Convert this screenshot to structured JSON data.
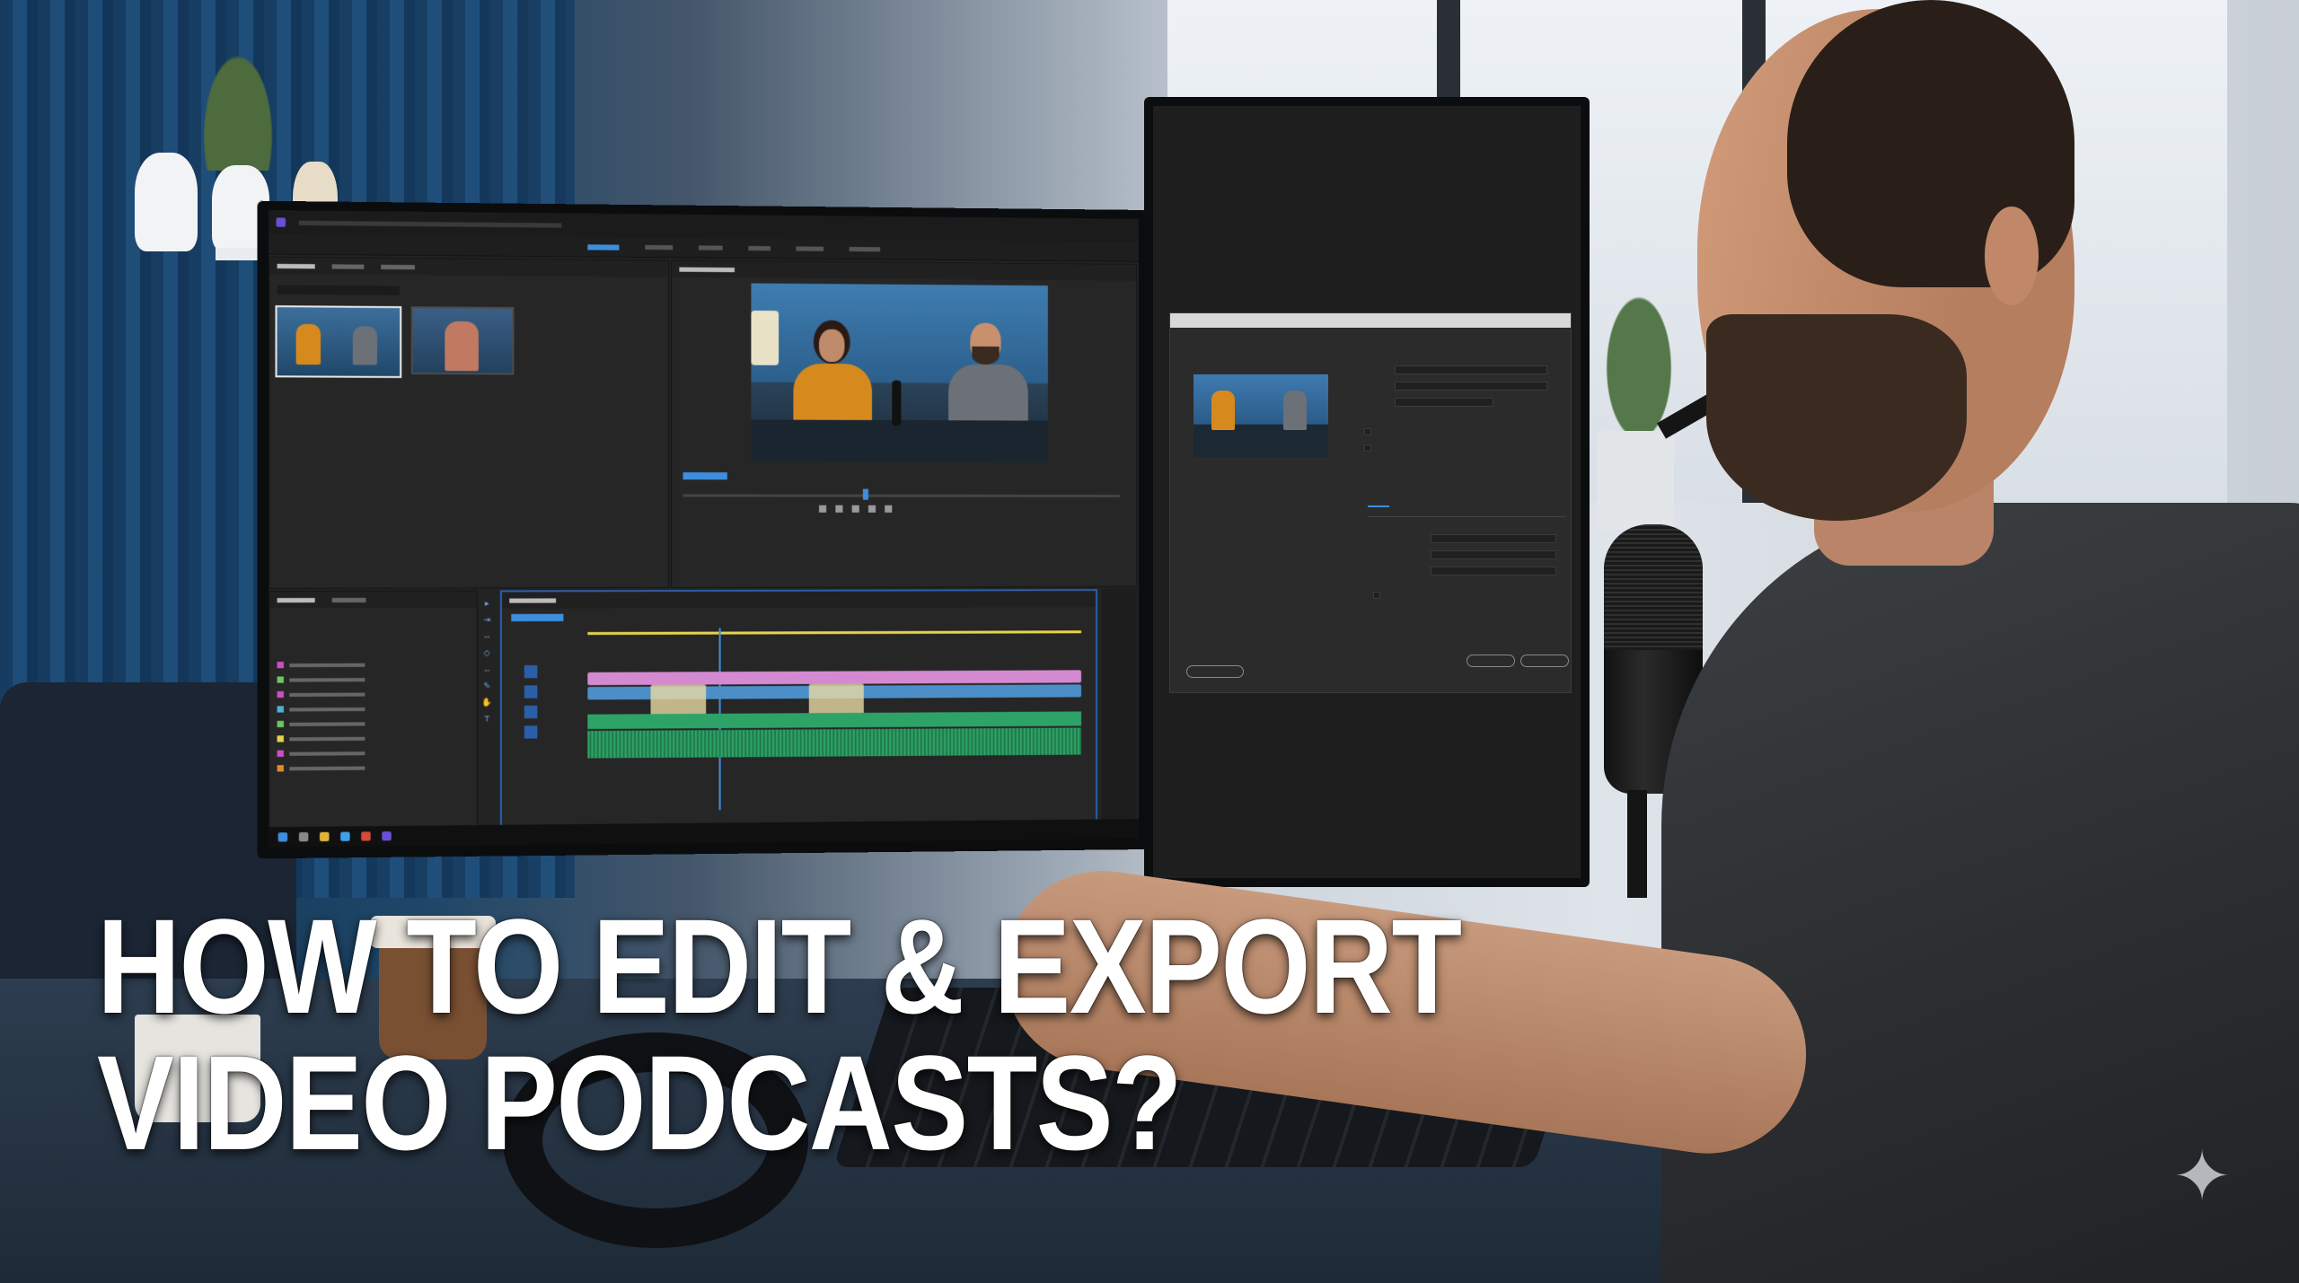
{
  "headline": {
    "line1": "HOW TO EDIT & EXPORT",
    "line2": "VIDEO PODCASTS?"
  },
  "editor": {
    "workspace_tabs": [
      "",
      "",
      "",
      "",
      "",
      ""
    ],
    "active_workspace_index": 0
  },
  "colors": {
    "headline_text": "#ffffff",
    "editor_bg": "#232323",
    "accent_blue": "#3e8ede",
    "video_track": "#d38ad0",
    "audio_track": "#2ea368",
    "playhead": "#e6d34a"
  },
  "icons": {
    "watermark": "sparkle-icon"
  }
}
